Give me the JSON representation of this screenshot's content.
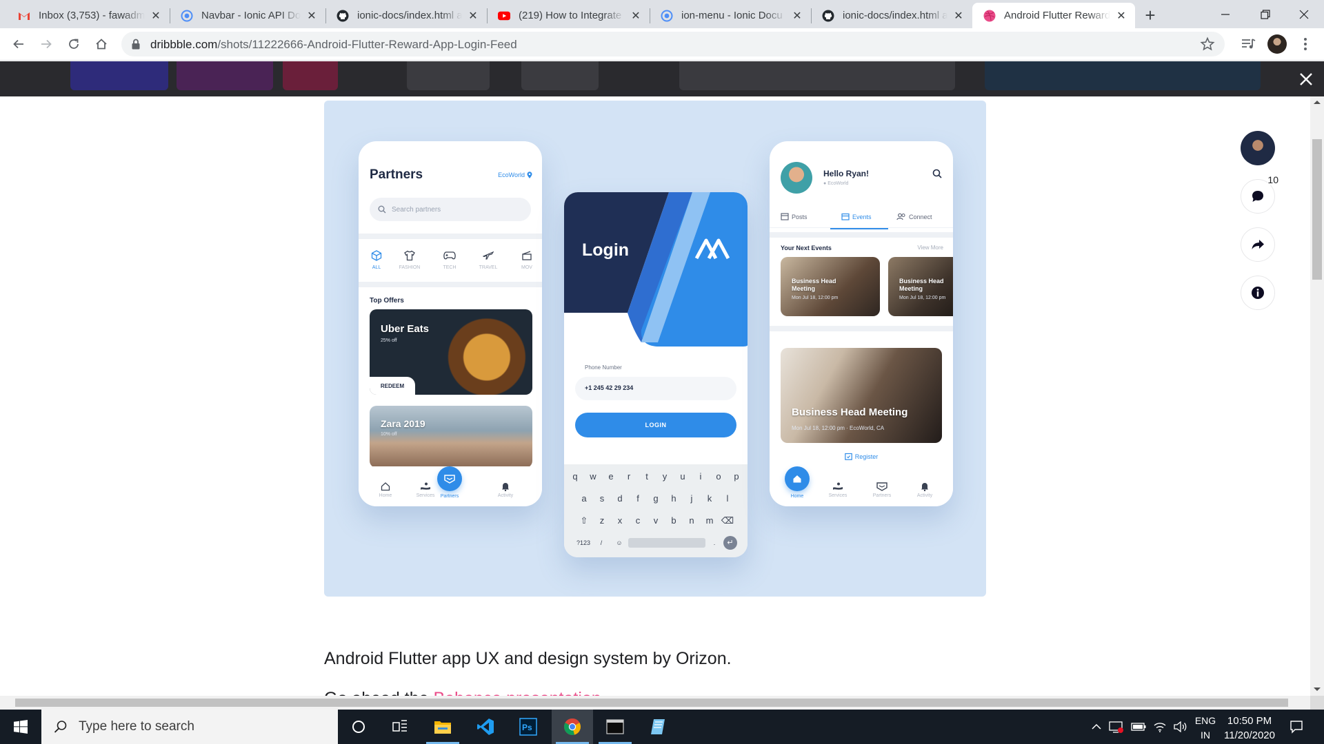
{
  "browser": {
    "tabs": [
      {
        "title": "Inbox (3,753) - fawadm",
        "icon": "gmail-icon"
      },
      {
        "title": "Navbar - Ionic API Docs",
        "icon": "ionic-icon"
      },
      {
        "title": "ionic-docs/index.html at",
        "icon": "github-icon"
      },
      {
        "title": "(219) How to Integrate",
        "icon": "youtube-icon"
      },
      {
        "title": "ion-menu - Ionic Docu",
        "icon": "ionic-icon"
      },
      {
        "title": "ionic-docs/index.html at",
        "icon": "github-icon"
      },
      {
        "title": "Android Flutter Reward",
        "icon": "dribbble-icon",
        "active": true
      }
    ],
    "url_host": "dribbble.com",
    "url_path": "/shots/11222666-Android-Flutter-Reward-App-Login-Feed"
  },
  "shot": {
    "partners": {
      "title": "Partners",
      "location": "EcoWorld",
      "search_placeholder": "Search partners",
      "categories": [
        "ALL",
        "FASHION",
        "TECH",
        "TRAVEL",
        "MOV"
      ],
      "section": "Top Offers",
      "offer1_name": "Uber Eats",
      "offer1_discount": "25% off",
      "offer1_cta": "REDEEM",
      "offer2_name": "Zara 2019",
      "offer2_discount": "10% off"
    },
    "login": {
      "title": "Login",
      "phone_label": "Phone Number",
      "phone_value": "+1 245 42 29 234",
      "button": "LOGIN",
      "kbd_row1": [
        "q",
        "w",
        "e",
        "r",
        "t",
        "y",
        "u",
        "i",
        "o",
        "p"
      ],
      "kbd_row2": [
        "a",
        "s",
        "d",
        "f",
        "g",
        "h",
        "j",
        "k",
        "l"
      ],
      "kbd_row3": [
        "z",
        "x",
        "c",
        "v",
        "b",
        "n",
        "m"
      ],
      "kbd_mode": "?123"
    },
    "feed": {
      "greeting": "Hello Ryan!",
      "location": "EcoWorld",
      "tab_posts": "Posts",
      "tab_events": "Events",
      "tab_connect": "Connect",
      "section": "Your Next Events",
      "view_more": "View More",
      "event_small_title": "Business Head Meeting",
      "event_small_time": "Mon Jul 18, 12:00 pm",
      "event_big_title": "Business Head Meeting",
      "event_big_meta": "Mon Jul 18, 12:00 pm · EcoWorld, CA",
      "register": "Register"
    },
    "nav": [
      "Home",
      "Services",
      "Partners",
      "Activity"
    ]
  },
  "description": "Android Flutter app UX and design system by Orizon.",
  "description2_prefix": "Go ahead the",
  "description2_link": "Behance presentation",
  "comments_count": "10",
  "taskbar": {
    "search_placeholder": "Type here to search",
    "lang_line1": "ENG",
    "lang_line2": "IN",
    "time": "10:50 PM",
    "date": "11/20/2020"
  },
  "colors": {
    "accent": "#2f8ce8",
    "navy": "#1f2a44",
    "shot_bg": "#d3e3f5",
    "dribbble_pink": "#ea4c89"
  }
}
